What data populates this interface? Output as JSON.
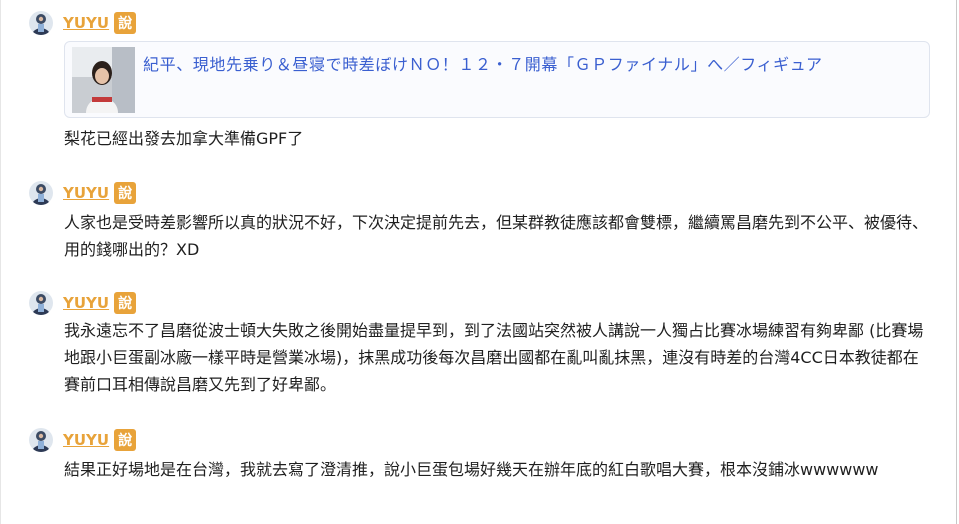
{
  "posts": [
    {
      "username": "YUYU",
      "badge": "說",
      "link_title": "紀平、現地先乗り＆昼寝で時差ぼけＮＯ！１２・７開幕「ＧＰファイナル」へ／フィギュア",
      "text": "梨花已經出發去加拿大準備GPF了"
    },
    {
      "username": "YUYU",
      "badge": "說",
      "text": "人家也是受時差影響所以真的狀況不好，下次決定提前先去，但某群教徒應該都會雙標，繼續罵昌磨先到不公平、被優待、用的錢哪出的？XD"
    },
    {
      "username": "YUYU",
      "badge": "說",
      "text": "我永遠忘不了昌磨從波士頓大失敗之後開始盡量提早到，到了法國站突然被人講說一人獨占比賽冰場練習有夠卑鄙 (比賽場地跟小巨蛋副冰廠一樣平時是營業冰場)，抹黑成功後每次昌磨出國都在亂叫亂抹黑，連沒有時差的台灣4CC日本教徒都在賽前口耳相傳說昌磨又先到了好卑鄙。"
    },
    {
      "username": "YUYU",
      "badge": "說",
      "text": "結果正好場地是在台灣，我就去寫了澄清推，說小巨蛋包場好幾天在辦年底的紅白歌唱大賽，根本沒鋪冰wwwwww"
    }
  ],
  "colors": {
    "username": "#e8a33a",
    "badge_bg": "#e8a33a",
    "link": "#3a5fd0",
    "text": "#1f1f1f"
  },
  "icons": {
    "avatar": "user-avatar-icon",
    "link_thumbnail": "article-thumbnail-photo"
  }
}
